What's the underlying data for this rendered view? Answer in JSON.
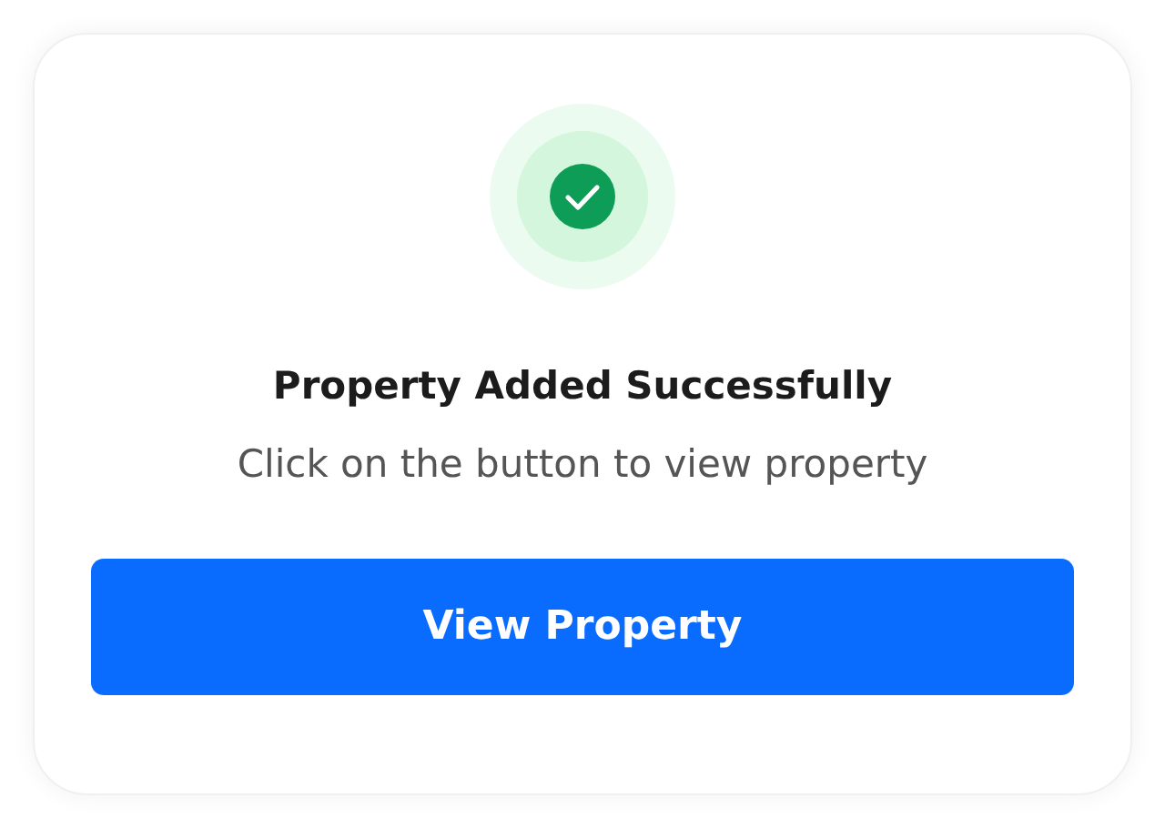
{
  "title": "Property Added Successfully",
  "message": "Click on the button to view property",
  "button": {
    "label": "View Property"
  }
}
